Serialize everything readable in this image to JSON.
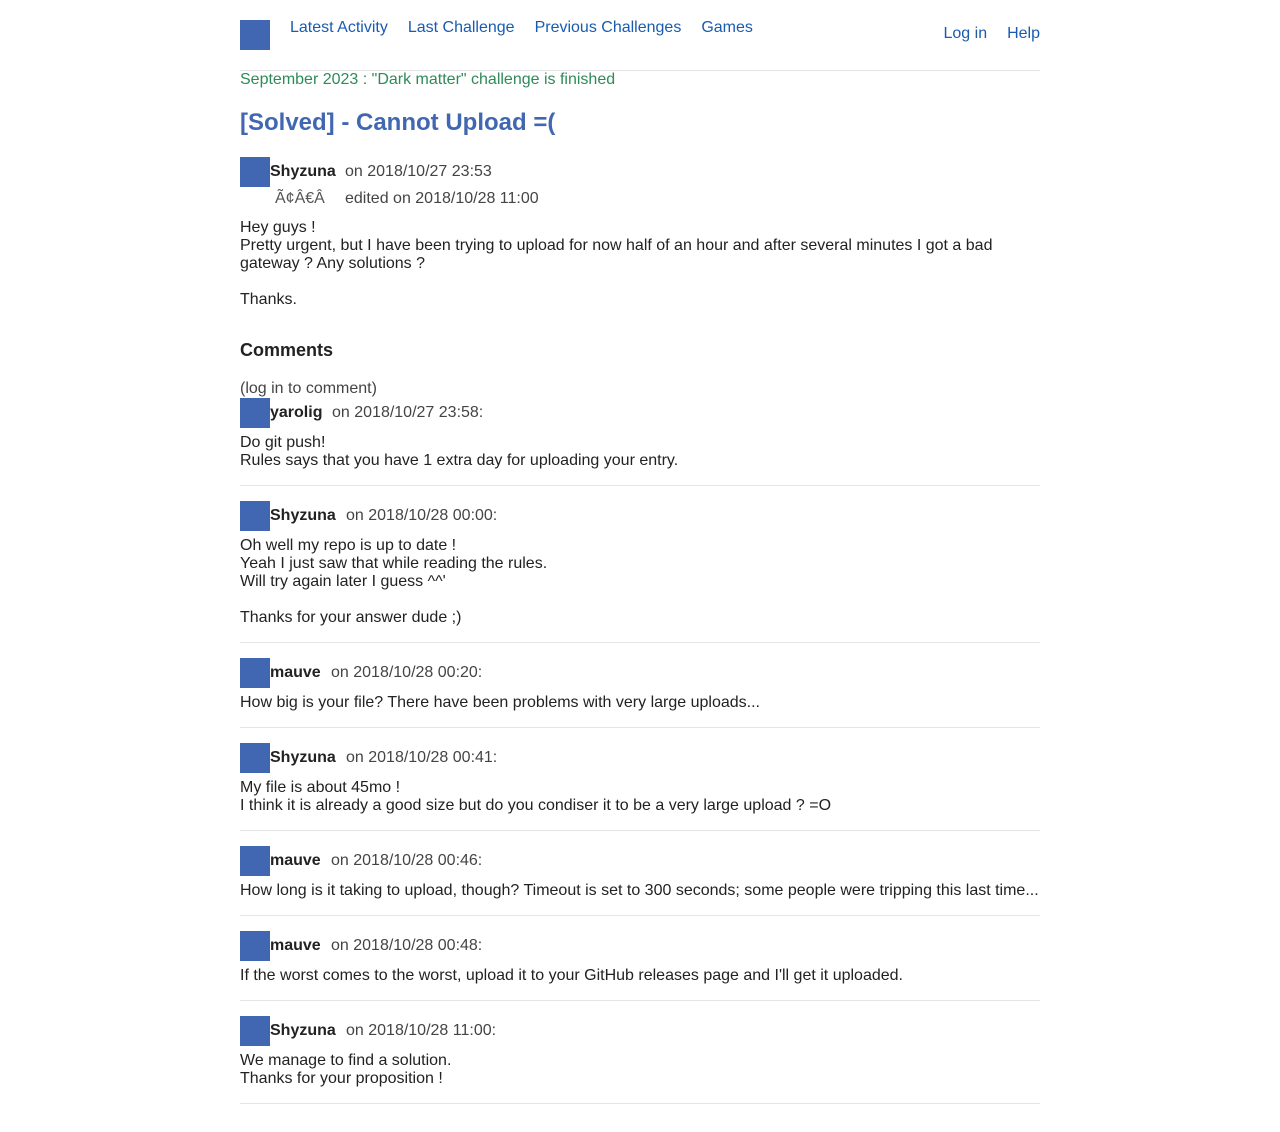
{
  "nav": {
    "items": [
      "Latest Activity",
      "Last Challenge",
      "Previous Challenges",
      "Games"
    ],
    "login": "Log in",
    "help": "Help"
  },
  "banner": "September 2023 : \"Dark matter\" challenge is finished",
  "title": "[Solved] - Cannot Upload =(",
  "post": {
    "author": "Shyzuna",
    "date": "on 2018/10/27 23:53",
    "glyph": "Ã¢Â€Â",
    "edited": "edited on 2018/10/28 11:00",
    "lines": [
      "Hey guys !",
      "Pretty urgent, but I have been trying to upload for now half of an hour and after several minutes I got a bad gateway ? Any solutions ?",
      "",
      "Thanks."
    ]
  },
  "comments_heading": "Comments",
  "login_note": "(log in to comment)",
  "comments": [
    {
      "author": "yarolig",
      "date": "on 2018/10/27 23:58:",
      "lines": [
        "Do git push!",
        "Rules says that you have 1 extra day for uploading your entry."
      ]
    },
    {
      "author": "Shyzuna",
      "date": "on 2018/10/28 00:00:",
      "lines": [
        "Oh well my repo is up to date !",
        "Yeah I just saw that while reading the rules.",
        "Will try again later I guess ^^'",
        "",
        "Thanks for your answer dude ;)"
      ]
    },
    {
      "author": "mauve",
      "date": "on 2018/10/28 00:20:",
      "lines": [
        "How big is your file? There have been problems with very large uploads..."
      ]
    },
    {
      "author": "Shyzuna",
      "date": "on 2018/10/28 00:41:",
      "lines": [
        "My file is about 45mo !",
        "I think it is already a good size but do you condiser it to be a very large upload ? =O"
      ]
    },
    {
      "author": "mauve",
      "date": "on 2018/10/28 00:46:",
      "lines": [
        "How long is it taking to upload, though? Timeout is set to 300 seconds; some people were tripping this last time..."
      ]
    },
    {
      "author": "mauve",
      "date": "on 2018/10/28 00:48:",
      "lines": [
        "If the worst comes to the worst, upload it to your GitHub releases page and I'll get it uploaded."
      ]
    },
    {
      "author": "Shyzuna",
      "date": "on 2018/10/28 11:00:",
      "lines": [
        "We manage to find a solution.",
        "Thanks for your proposition !"
      ]
    }
  ]
}
